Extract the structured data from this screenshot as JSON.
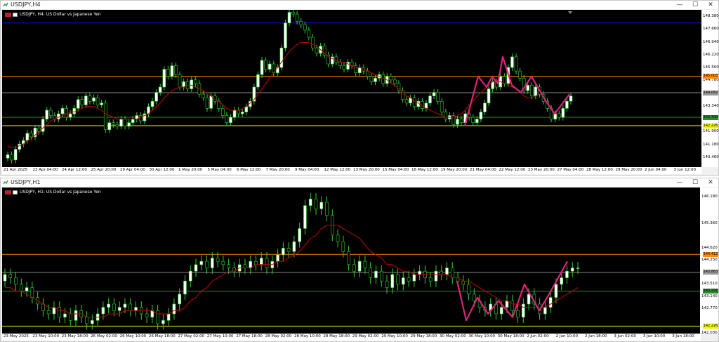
{
  "colors": {
    "background": "#000000",
    "bull_candle": "#ffffff",
    "bear_candle": "#000000",
    "wick": "#33cc33",
    "moving_average": "#c00000",
    "pattern_line": "#e0207a",
    "orange_line": "#ff8c00",
    "yellow_line": "#f0f000",
    "blue_line": "#1010ff",
    "grey_line": "#8a8a8a",
    "green_line": "#2e8b2e"
  },
  "windows": [
    {
      "title": "USDJPY,H4",
      "app_icon": "chart-app-icon",
      "info_text": "USDJPY, H4:  US Dollar vs Japanese Yen",
      "price_ticks": [
        "148.380",
        "147.660",
        "146.940",
        "146.220",
        "145.500",
        "144.780",
        "143.340",
        "141.900",
        "141.180",
        "140.460"
      ],
      "tags": {
        "orange": "145.003",
        "grey": "144.082",
        "green": "142.700",
        "yellow": "142.226"
      },
      "time_labels": [
        "21 Apr 2025",
        "23 Apr 04:00",
        "24 Apr 12:00",
        "25 Apr 20:00",
        "29 Apr 04:00",
        "30 Apr 12:00",
        "1 May 20:00",
        "5 May 04:00",
        "6 May 12:00",
        "7 May 20:00",
        "9 May 04:00",
        "12 May 12:00",
        "13 May 20:00",
        "15 May 04:00",
        "16 May 12:00",
        "19 May 20:00",
        "21 May 04:00",
        "22 May 12:00",
        "23 May 20:00",
        "27 May 04:00",
        "28 May 12:00",
        "29 May 20:00",
        "2 Jun 04:00",
        "3 Jun 12:00"
      ],
      "candles": [
        140.6,
        140.3,
        140.9,
        141.2,
        141.4,
        141.8,
        141.6,
        142.1,
        141.9,
        142.6,
        143.1,
        142.8,
        142.6,
        142.9,
        143.2,
        142.7,
        142.9,
        143.2,
        143.7,
        143.4,
        143.9,
        143.6,
        143.8,
        143.4,
        143.5,
        142.0,
        142.4,
        142.3,
        142.2,
        142.6,
        142.2,
        142.4,
        142.6,
        142.8,
        142.5,
        142.9,
        143.3,
        143.6,
        144.1,
        144.4,
        145.4,
        145.0,
        145.6,
        145.1,
        144.4,
        144.7,
        144.3,
        144.8,
        144.6,
        144.0,
        143.8,
        143.2,
        143.9,
        143.6,
        143.2,
        142.8,
        142.4,
        142.7,
        143.1,
        142.9,
        143.0,
        143.3,
        143.6,
        144.4,
        145.1,
        145.9,
        145.4,
        145.7,
        145.2,
        145.5,
        146.6,
        148.0,
        148.6,
        148.5,
        148.1,
        147.9,
        147.6,
        147.2,
        146.6,
        146.3,
        146.7,
        146.2,
        145.7,
        146.1,
        145.8,
        145.6,
        145.4,
        145.8,
        145.6,
        145.2,
        145.5,
        145.3,
        145.0,
        144.7,
        144.9,
        145.1,
        144.6,
        145.0,
        144.8,
        144.6,
        144.2,
        143.7,
        143.5,
        143.8,
        143.3,
        143.6,
        143.2,
        143.5,
        143.9,
        144.1,
        143.6,
        143.0,
        142.6,
        142.8,
        142.3,
        142.6,
        142.4,
        142.9,
        142.7,
        142.4,
        142.6,
        143.0,
        143.5,
        144.3,
        144.7,
        144.4,
        145.0,
        144.6,
        145.5,
        146.1,
        145.3,
        144.9,
        144.2,
        144.5,
        143.9,
        144.4,
        144.0,
        143.6,
        143.2,
        142.6,
        142.9,
        142.7,
        143.2,
        143.6,
        143.9
      ],
      "ma": [
        141.1,
        141.0,
        141.0,
        141.1,
        141.2,
        141.4,
        141.5,
        141.7,
        141.9,
        142.1,
        142.3,
        142.5,
        142.6,
        142.7,
        142.8,
        142.9,
        143.0,
        143.0,
        143.1,
        143.2,
        143.3,
        143.3,
        143.3,
        143.2,
        143.1,
        142.9,
        142.8,
        142.7,
        142.6,
        142.6,
        142.6,
        142.6,
        142.6,
        142.6,
        142.7,
        142.8,
        142.9,
        143.1,
        143.3,
        143.5,
        143.8,
        144.0,
        144.2,
        144.3,
        144.4,
        144.4,
        144.5,
        144.5,
        144.4,
        144.3,
        144.2,
        144.0,
        143.9,
        143.7,
        143.6,
        143.4,
        143.2,
        143.1,
        143.1,
        143.1,
        143.2,
        143.3,
        143.5,
        143.7,
        144.0,
        144.3,
        144.6,
        144.9,
        145.2,
        145.5,
        145.8,
        146.1,
        146.4,
        146.6,
        146.8,
        146.9,
        146.9,
        146.9,
        146.8,
        146.7,
        146.5,
        146.3,
        146.1,
        146.0,
        145.9,
        145.8,
        145.8,
        145.7,
        145.6,
        145.5,
        145.5,
        145.4,
        145.3,
        145.2,
        145.1,
        145.0,
        144.9,
        144.8,
        144.6,
        144.5,
        144.3,
        144.1,
        143.9,
        143.8,
        143.6,
        143.5,
        143.3,
        143.2,
        143.1,
        143.0,
        142.9,
        142.8,
        142.7,
        142.7,
        142.7,
        142.8,
        142.9,
        143.1,
        143.4,
        143.6,
        143.9,
        144.1,
        144.3,
        144.5,
        144.7,
        144.8,
        144.7,
        144.6,
        144.5,
        144.4,
        144.3,
        144.1,
        143.9,
        143.8,
        143.8,
        143.9,
        144.0
      ]
    },
    {
      "title": "USDJPY,H1",
      "app_icon": "chart-app-icon",
      "info_text": "USDJPY, H1:  US Dollar vs Japanese Yen",
      "price_ticks": [
        "146.180",
        "145.360",
        "144.620",
        "144.250",
        "143.510",
        "143.140",
        "142.770",
        "142.030"
      ],
      "tags": {
        "orange": "144.412",
        "grey": "143.863",
        "green": "143.291",
        "yellow": "142.226"
      },
      "time_labels": [
        "23 May 2025",
        "23 May 10:00",
        "23 May 18:00",
        "26 May 02:00",
        "26 May 10:00",
        "26 May 18:00",
        "27 May 02:00",
        "27 May 10:00",
        "27 May 18:00",
        "28 May 02:00",
        "28 May 10:00",
        "28 May 18:00",
        "29 May 02:00",
        "29 May 10:00",
        "29 May 18:00",
        "30 May 02:00",
        "30 May 10:00",
        "30 May 18:00",
        "2 Jun 02:00",
        "2 Jun 10:00",
        "2 Jun 18:00",
        "3 Jun 02:00",
        "3 Jun 10:00",
        "3 Jun 18:00"
      ],
      "candles": [
        143.8,
        143.7,
        143.5,
        143.3,
        143.4,
        143.1,
        142.9,
        142.7,
        142.6,
        142.8,
        142.5,
        142.6,
        142.4,
        142.7,
        142.5,
        142.3,
        142.4,
        142.6,
        142.8,
        142.9,
        142.7,
        142.8,
        142.9,
        142.7,
        142.8,
        142.6,
        142.5,
        142.7,
        142.3,
        142.4,
        142.6,
        142.9,
        143.2,
        143.6,
        143.9,
        144.1,
        144.2,
        144.0,
        144.3,
        144.2,
        144.1,
        144.0,
        143.9,
        144.1,
        144.0,
        144.2,
        144.1,
        144.3,
        144.0,
        144.2,
        144.4,
        144.6,
        144.5,
        144.8,
        145.2,
        145.9,
        146.1,
        145.8,
        146.0,
        145.6,
        145.0,
        144.8,
        144.5,
        144.1,
        143.9,
        144.2,
        144.0,
        143.7,
        143.9,
        143.6,
        143.4,
        143.8,
        143.5,
        143.7,
        143.6,
        143.8,
        143.9,
        143.7,
        143.6,
        143.9,
        143.8,
        144.0,
        143.7,
        143.6,
        143.5,
        143.2,
        143.0,
        142.8,
        142.7,
        142.9,
        142.6,
        142.8,
        143.0,
        142.7,
        142.5,
        142.9,
        143.2,
        142.9,
        142.6,
        142.8,
        143.1,
        143.5,
        143.7,
        143.9,
        144.0,
        144.0
      ],
      "ma": [
        143.4,
        143.4,
        143.3,
        143.3,
        143.2,
        143.1,
        143.0,
        142.9,
        142.8,
        142.8,
        142.7,
        142.7,
        142.6,
        142.6,
        142.6,
        142.5,
        142.5,
        142.5,
        142.5,
        142.6,
        142.6,
        142.6,
        142.7,
        142.7,
        142.7,
        142.7,
        142.7,
        142.7,
        142.6,
        142.6,
        142.6,
        142.7,
        142.7,
        142.8,
        143.0,
        143.1,
        143.3,
        143.4,
        143.6,
        143.7,
        143.8,
        143.9,
        143.9,
        144.0,
        144.0,
        144.0,
        144.1,
        144.1,
        144.1,
        144.1,
        144.2,
        144.2,
        144.3,
        144.4,
        144.5,
        144.7,
        144.9,
        145.0,
        145.2,
        145.3,
        145.3,
        145.3,
        145.2,
        145.1,
        145.0,
        144.9,
        144.7,
        144.5,
        144.4,
        144.3,
        144.1,
        144.1,
        144.0,
        143.9,
        143.9,
        143.8,
        143.8,
        143.8,
        143.8,
        143.8,
        143.8,
        143.8,
        143.7,
        143.7,
        143.6,
        143.6,
        143.5,
        143.4,
        143.3,
        143.2,
        143.1,
        143.0,
        143.0,
        142.9,
        142.9,
        142.8,
        142.8,
        142.8,
        142.8,
        142.8,
        142.9,
        143.0,
        143.1,
        143.2,
        143.3,
        143.4
      ]
    }
  ],
  "pattern_h4": [
    [
      142.226,
      659
    ],
    [
      145.0,
      678
    ],
    [
      144.4,
      690
    ],
    [
      145.0,
      698
    ],
    [
      144.6,
      706
    ],
    [
      146.1,
      713
    ],
    [
      144.5,
      726
    ],
    [
      144.1,
      739
    ],
    [
      145.0,
      754
    ],
    [
      143.7,
      773
    ],
    [
      142.9,
      787
    ],
    [
      144.0,
      808
    ]
  ],
  "pattern_h1": [
    [
      143.6,
      648
    ],
    [
      142.4,
      661
    ],
    [
      143.1,
      677
    ],
    [
      142.6,
      692
    ],
    [
      143.0,
      707
    ],
    [
      142.5,
      727
    ],
    [
      143.5,
      744
    ],
    [
      142.7,
      765
    ],
    [
      143.2,
      779
    ],
    [
      144.2,
      805
    ]
  ]
}
